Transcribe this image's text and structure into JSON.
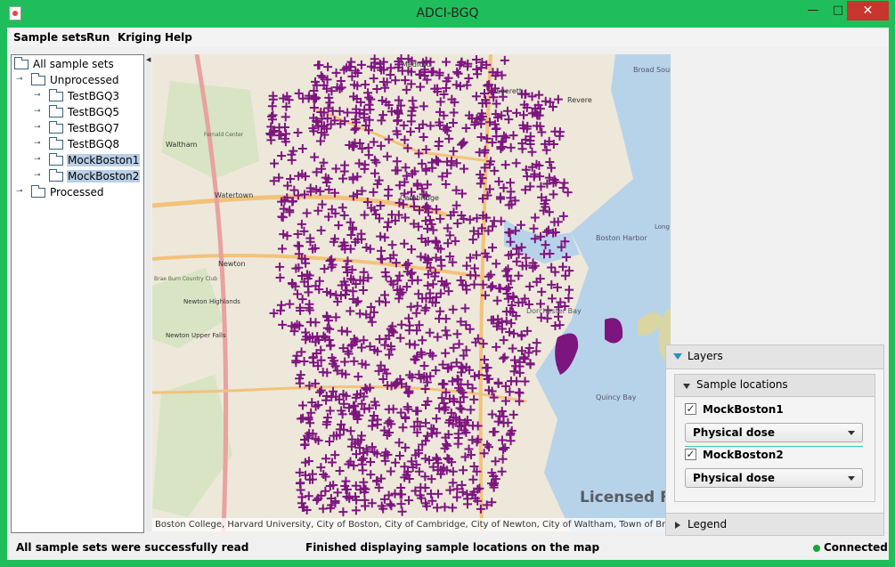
{
  "window": {
    "title": "ADCI-BGQ",
    "minimize": "—",
    "maximize": "□",
    "close": "✕"
  },
  "menu": [
    "Sample sets",
    "Run",
    "Kriging",
    "Help"
  ],
  "tree": {
    "root": "All sample sets",
    "unprocessed": "Unprocessed",
    "items": [
      "TestBGQ3",
      "TestBGQ5",
      "TestBGQ7",
      "TestBGQ8",
      "MockBoston1",
      "MockBoston2"
    ],
    "processed": "Processed"
  },
  "map": {
    "labels": [
      "Medford",
      "Everett",
      "Revere",
      "Broad Sound",
      "Cambridge",
      "Waltham",
      "Watertown",
      "Newton",
      "Boston Harbor",
      "Long Island",
      "Dorchester Bay",
      "Quincy Bay",
      "Newton Upper Falls",
      "Newton Highlands",
      "Brae Burn Country Club",
      "Fernald Center"
    ],
    "attribution": "Boston College, Harvard University, City of Boston, City of Cambridge, City of Newton, City of Waltham, Town of Brookline",
    "watermark": "Licensed F",
    "marker_color": "#7d157f",
    "water_color": "#b7d3ea"
  },
  "layers": {
    "title": "Layers",
    "sample_locations": "Sample locations",
    "sets": [
      {
        "name": "MockBoston1",
        "checked": true,
        "attribute": "Physical dose"
      },
      {
        "name": "MockBoston2",
        "checked": true,
        "attribute": "Physical dose"
      }
    ],
    "legend": "Legend"
  },
  "status": {
    "left": "All sample sets were successfully read",
    "center": "Finished displaying sample locations on the map",
    "connection": "Connected",
    "connection_color": "#1aa23a"
  }
}
